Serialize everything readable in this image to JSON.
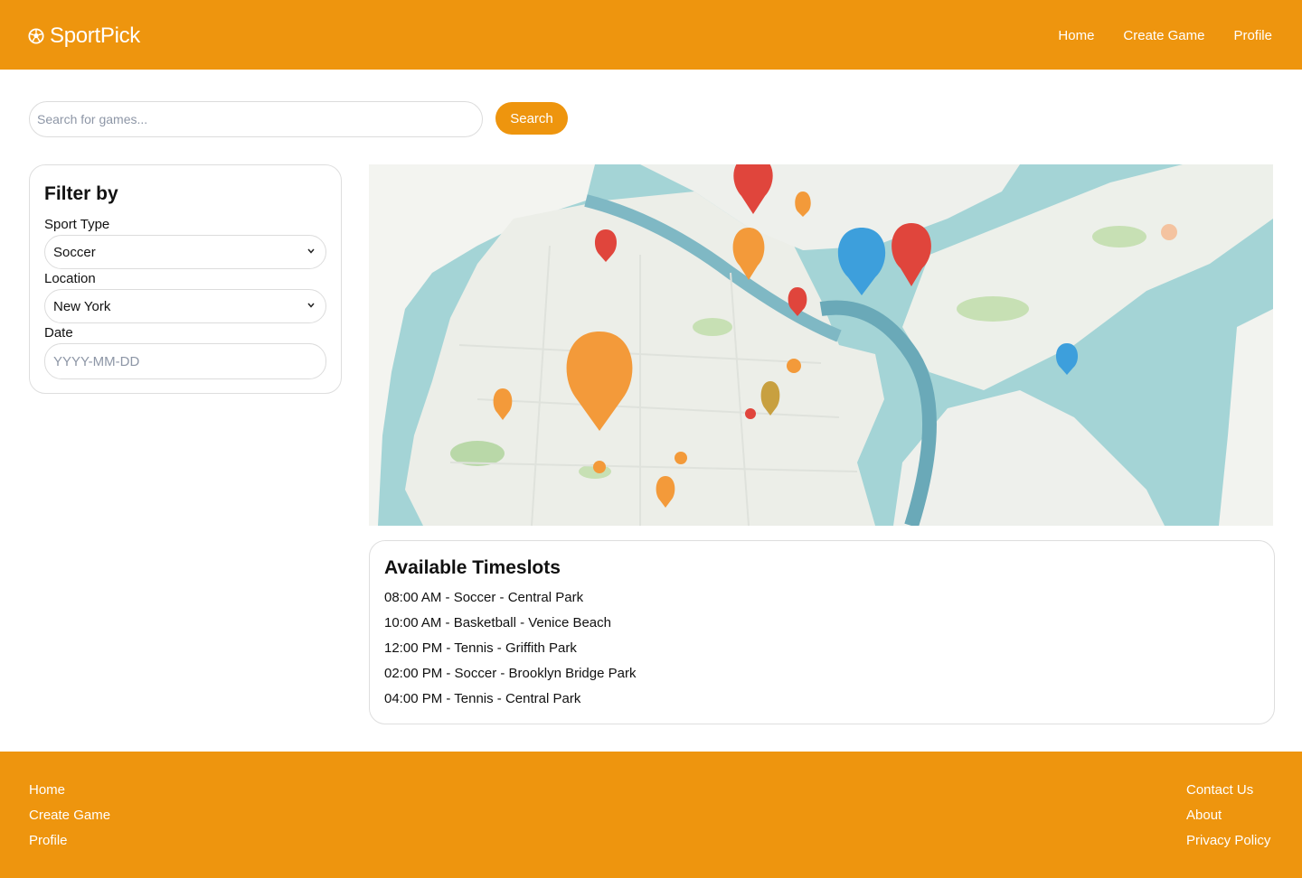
{
  "header": {
    "brand_name": "SportPick",
    "brand_icon": "soccer-ball-icon",
    "nav": [
      "Home",
      "Create Game",
      "Profile"
    ]
  },
  "search": {
    "placeholder": "Search for games...",
    "button_label": "Search"
  },
  "filters": {
    "title": "Filter by",
    "sport_type_label": "Sport Type",
    "sport_type_value": "Soccer",
    "location_label": "Location",
    "location_value": "New York",
    "date_label": "Date",
    "date_placeholder": "YYYY-MM-DD"
  },
  "map": {
    "content": "city-map-with-pins",
    "colors": {
      "water": "#a4d4d6",
      "land": "#eef0ec",
      "pin_orange": "#f39a3a",
      "pin_red": "#e0453c",
      "pin_blue": "#3d9fdc"
    }
  },
  "timeslots": {
    "title": "Available Timeslots",
    "items": [
      "08:00 AM - Soccer - Central Park",
      "10:00 AM - Basketball - Venice Beach",
      "12:00 PM - Tennis - Griffith Park",
      "02:00 PM - Soccer - Brooklyn Bridge Park",
      "04:00 PM - Tennis - Central Park"
    ]
  },
  "footer": {
    "left_links": [
      "Home",
      "Create Game",
      "Profile"
    ],
    "right_links": [
      "Contact Us",
      "About",
      "Privacy Policy"
    ]
  },
  "theme": {
    "accent": "#ee950e"
  }
}
